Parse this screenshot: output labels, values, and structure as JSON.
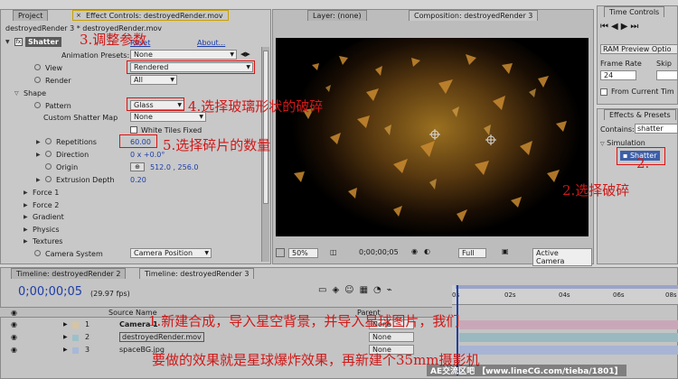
{
  "colors": {
    "accent": "#e01010",
    "value_blue": "#1c3da8",
    "comp_bg": "#000000"
  },
  "project_tab": "Project",
  "effect_tab": "Effect Controls: destroyedRender.mov",
  "effect_breadcrumb": "destroyedRender 3 * destroyedRender.mov",
  "effect_name": "Shatter",
  "reset_label": "Reset",
  "about_label": "About...",
  "anim_presets_label": "Animation Presets:",
  "anim_presets_value": "None",
  "props": {
    "view_label": "View",
    "view_value": "Rendered",
    "render_label": "Render",
    "render_value": "All",
    "shape_label": "Shape",
    "pattern_label": "Pattern",
    "pattern_value": "Glass",
    "custom_map_label": "Custom Shatter Map",
    "custom_map_value": "None",
    "white_tiles": "White Tiles Fixed",
    "repetitions_label": "Repetitions",
    "repetitions_value": "60.00",
    "direction_label": "Direction",
    "direction_value": "0 x +0.0°",
    "origin_label": "Origin",
    "origin_value": "512.0 , 256.0",
    "extrusion_label": "Extrusion Depth",
    "extrusion_value": "0.20",
    "force1": "Force 1",
    "force2": "Force 2",
    "gradient": "Gradient",
    "physics": "Physics",
    "textures": "Textures",
    "camera_system_label": "Camera System",
    "camera_system_value": "Camera Position"
  },
  "layer_tab": "Layer: (none)",
  "comp_tab": "Composition: destroyedRender 3",
  "viewer": {
    "zoom": "50%",
    "timecode": "0;00;00;05",
    "quality": "Full",
    "camera": "Active Camera"
  },
  "time_controls": {
    "title": "Time Controls",
    "ram_preview": "RAM Preview Optio",
    "frame_rate_label": "Frame Rate",
    "skip_label": "Skip",
    "frame_rate_value": "24",
    "from_current": "From Current Tim"
  },
  "effects_presets": {
    "title": "Effects & Presets",
    "contains_label": "Contains:",
    "contains_value": "shatter",
    "category": "Simulation",
    "result": "Shatter"
  },
  "timeline": {
    "tab1": "Timeline: destroyedRender 2",
    "tab2": "Timeline: destroyedRender 3",
    "timecode": "0;00;00;05",
    "fps": "(29.97 fps)",
    "col_source": "Source Name",
    "col_parent": "Parent",
    "ruler": [
      "0s",
      "02s",
      "04s",
      "06s",
      "08s"
    ],
    "layers": [
      {
        "num": "1",
        "name": "Camera 1",
        "parent": "None"
      },
      {
        "num": "2",
        "name": "destroyedRender.mov",
        "parent": "None"
      },
      {
        "num": "3",
        "name": "spaceBG.jpg",
        "parent": "None"
      }
    ]
  },
  "annotations": {
    "step3": "3.调整参数",
    "step4": "4.选择玻璃形状的破碎",
    "step5": "5.选择碎片的数量",
    "step2a": "2.",
    "step2b": "2.选择破碎",
    "step1a": "1.新建合成，导入星空背景，并导入星球图片，我们",
    "step1b": "要做的效果就是星球爆炸效果，再新建个35mm摄影机"
  },
  "watermark": "AE交流区吧 【www.lineCG.com/tieba/1801】"
}
